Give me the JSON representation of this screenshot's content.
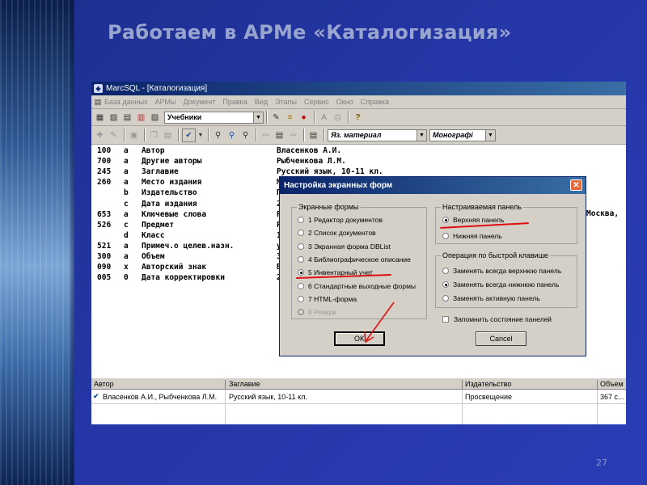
{
  "slide": {
    "title": "Работаем в АРМе «Каталогизация»",
    "page_number": "27"
  },
  "window": {
    "title": "MarcSQL - [Каталогизация]",
    "menu": [
      "База данных",
      "АРМы",
      "Документ",
      "Правка",
      "Вид",
      "Этапы",
      "Сервис",
      "Окно",
      "Справка"
    ],
    "toolbar1_combo": "Учебники",
    "toolbar2_combo1": "Яз. материал",
    "toolbar2_combo2": "Монографі"
  },
  "record": [
    {
      "tag": "100",
      "sub": "a",
      "name": "Автор",
      "value": "Власенков А.И."
    },
    {
      "tag": "700",
      "sub": "a",
      "name": "Другие авторы",
      "value": "Рыбченкова Л.М."
    },
    {
      "tag": "245",
      "sub": "a",
      "name": "Заглавие",
      "value": "Русский язык, 10-11 кл."
    },
    {
      "tag": "260",
      "sub": "a",
      "name": "Место издания",
      "value": "М"
    },
    {
      "tag": "",
      "sub": "b",
      "name": "Издательство",
      "value": "П"
    },
    {
      "tag": "",
      "sub": "c",
      "name": "Дата издания",
      "value": "2"
    },
    {
      "tag": "653",
      "sub": "a",
      "name": "Ключевые слова",
      "value": "Р"
    },
    {
      "tag": "526",
      "sub": "c",
      "name": "Предмет",
      "value": "Р"
    },
    {
      "tag": "",
      "sub": "d",
      "name": "Класс",
      "value": "1"
    },
    {
      "tag": "521",
      "sub": "a",
      "name": "Примеч.о целев.назн.",
      "value": "у"
    },
    {
      "tag": "300",
      "sub": "a",
      "name": "Объем",
      "value": "3"
    },
    {
      "tag": "090",
      "sub": "x",
      "name": "Авторский знак",
      "value": "В"
    },
    {
      "tag": "005",
      "sub": "0",
      "name": "Дата корректировки",
      "value": "2"
    }
  ],
  "record_overflow_text": "Москва,",
  "grid": {
    "headers": [
      "Автор",
      "Заглавие",
      "Издательство",
      "Объем"
    ],
    "rows": [
      [
        "Власенков А.И., Рыбченкова Л.М.",
        "Русский язык, 10-11 кл.",
        "Просвещение",
        "367 с..."
      ]
    ]
  },
  "dialog": {
    "title": "Настройка экранных форм",
    "close_glyph": "✕",
    "forms_group": "Экранные формы",
    "forms": [
      {
        "label": "1 Редактор документов",
        "selected": false,
        "disabled": false
      },
      {
        "label": "2 Список документов",
        "selected": false,
        "disabled": false
      },
      {
        "label": "3 Экранная форма DBList",
        "selected": false,
        "disabled": false
      },
      {
        "label": "4 Библиографическое описание",
        "selected": false,
        "disabled": false
      },
      {
        "label": "5 Инвентарный учет",
        "selected": true,
        "disabled": false
      },
      {
        "label": "6 Стандартные выходные формы",
        "selected": false,
        "disabled": false
      },
      {
        "label": "7 HTML-форма",
        "selected": false,
        "disabled": false
      },
      {
        "label": "8 Резерв",
        "selected": false,
        "disabled": true
      }
    ],
    "panel_group": "Настраиваемая панель",
    "panels": [
      {
        "label": "Верхняя панель",
        "selected": true
      },
      {
        "label": "Нижняя панель",
        "selected": false
      }
    ],
    "hotkey_group": "Операция по быстрой клавише",
    "hotkey_ops": [
      {
        "label": "Заменять всегда верхнюю панель",
        "selected": false
      },
      {
        "label": "Заменять всегда нижнюю панель",
        "selected": true
      },
      {
        "label": "Заменять активную панель",
        "selected": false
      }
    ],
    "remember_label": "Запомнить состояние панелей",
    "remember_checked": false,
    "ok_label": "OK",
    "cancel_label": "Cancel"
  },
  "colors": {
    "slide_bg": "#2536a6",
    "title_text": "#9aa5cf",
    "annotation_red": "#e01010",
    "titlebar": "#0a246a"
  }
}
